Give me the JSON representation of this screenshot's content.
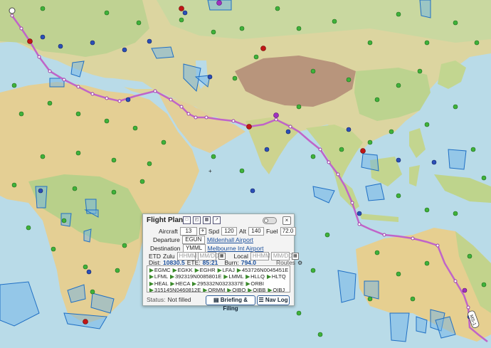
{
  "map": {
    "route_color": "#c064c8",
    "label": "MS-1",
    "colors": {
      "ocean": "#b9dbe8",
      "land": "#e8d7a4",
      "green_land": "#b8cf88",
      "tibet": "#b8957c",
      "airspace": "#2a7fd6",
      "dot_green": "#3fb23a",
      "dot_blue": "#2b4fb8",
      "dot_red": "#c01616",
      "dot_purple": "#a030c0"
    }
  },
  "flight_plan": {
    "title": "Flight Plan",
    "toolbar_icons": [
      "new-file-icon",
      "open-folder-icon",
      "save-icon",
      "export-icon"
    ],
    "aircraft_label": "Aircraft",
    "aircraft_value": "13",
    "spd_label": "Spd",
    "spd_value": "120",
    "alt_label": "Alt",
    "alt_value": "140",
    "fuel_label": "Fuel",
    "fuel_value": "72.0",
    "departure_label": "Departure",
    "departure_code": "EGUN",
    "departure_name": "Mildenhall Airport",
    "destination_label": "Destination",
    "destination_code": "YMML",
    "destination_name": "Melbourne Int Airport",
    "etd_label": "ETD",
    "zulu_label": "Zulu",
    "time_placeholder": "HHMM",
    "date_placeholder": "MM/DD",
    "local_label": "Local",
    "dist_label": "Dist:",
    "dist_value": "10830.5",
    "ete_label": "ETE:",
    "ete_value": "85:21",
    "burn_label": "Burn:",
    "burn_value": "794.0",
    "routes_label": "Routes",
    "route_lines": [
      [
        "EGMC",
        "EGKK",
        "EGHR",
        "LFAJ",
        "453726N0045451E"
      ],
      [
        "LFML",
        "392319N0085801E",
        "LMML",
        "HLLQ",
        "HLTQ"
      ],
      [
        "HEAL",
        "HECA",
        "295332N0323337E",
        "ORBI"
      ],
      [
        "315145N0460812E",
        "ORMM",
        "OIBQ",
        "OIBB",
        "OIBJ"
      ],
      [
        "265952N0532223E",
        "OIBL",
        "OIKQ",
        "OOKB",
        "OPKC"
      ]
    ],
    "status_label": "Status:",
    "status_value": "Not filled",
    "briefing_button": "Briefing & Filing",
    "navlog_button": "Nav Log"
  }
}
